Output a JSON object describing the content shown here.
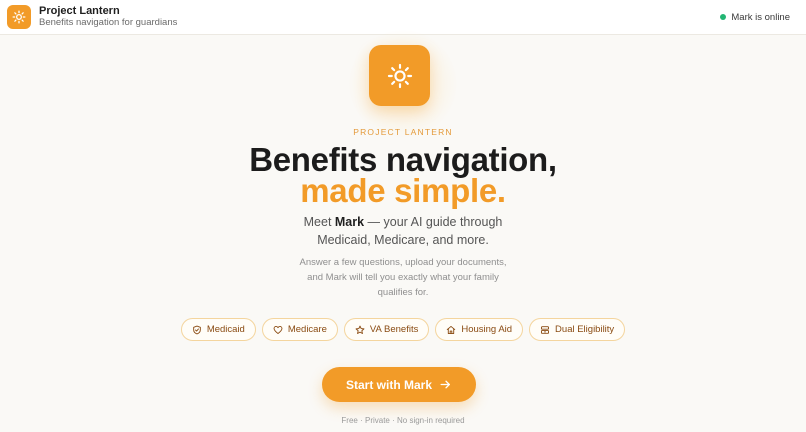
{
  "header": {
    "brand_title": "Project Lantern",
    "brand_subtitle": "Benefits navigation for guardians",
    "status_text": "Mark is online",
    "status_color": "#22b573",
    "logo_icon": "sun-icon"
  },
  "hero": {
    "icon": "sun-icon",
    "eyebrow": "PROJECT LANTERN",
    "headline_line1": "Benefits navigation,",
    "headline_line2": "made simple.",
    "lead_prefix": "Meet ",
    "lead_name": "Mark",
    "lead_suffix": " — your AI guide through",
    "lead_line2": "Medicaid, Medicare, and more.",
    "sub_text": "Answer a few questions, upload your documents, and Mark will tell you exactly what your family qualifies for."
  },
  "chips": [
    {
      "label": "Medicaid",
      "icon": "shield-icon"
    },
    {
      "label": "Medicare",
      "icon": "heart-icon"
    },
    {
      "label": "VA Benefits",
      "icon": "star-icon"
    },
    {
      "label": "Housing Aid",
      "icon": "home-icon"
    },
    {
      "label": "Dual Eligibility",
      "icon": "layers-icon"
    }
  ],
  "cta": {
    "label": "Start with Mark",
    "icon": "arrow-right-icon"
  },
  "footnote": "Free · Private · No sign-in required",
  "colors": {
    "accent": "#f29b28",
    "accent_text": "#8a4b12",
    "background": "#faf9f6"
  }
}
